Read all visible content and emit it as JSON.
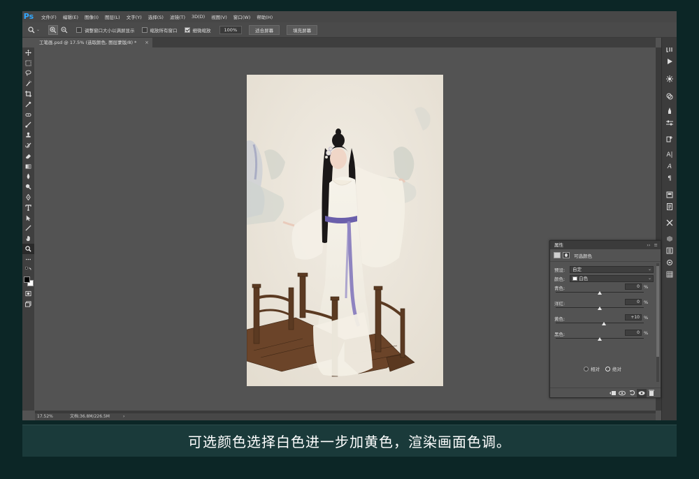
{
  "app": {
    "logo": "Ps",
    "menu": [
      "文件(F)",
      "编辑(E)",
      "图像(I)",
      "图层(L)",
      "文字(Y)",
      "选择(S)",
      "滤镜(T)",
      "3D(D)",
      "视图(V)",
      "窗口(W)",
      "帮助(H)"
    ]
  },
  "options": {
    "zoom_tool_icon": "zoom-icon",
    "resize_windows_label": "调整窗口大小以满屏显示",
    "resize_windows_checked": false,
    "zoom_all_label": "缩放所有窗口",
    "zoom_all_checked": false,
    "scrubby_label": "细微缩放",
    "scrubby_checked": true,
    "zoom_value": "100%",
    "fit_screen": "适合屏幕",
    "fill_screen": "填充屏幕"
  },
  "document": {
    "tab_title": "工笔画.psd @ 17.5% (选取颜色, 图层蒙版/8) *",
    "close": "×"
  },
  "statusbar": {
    "zoom": "17.52%",
    "doc_size": "文档:36.8M/226.5M",
    "arrow": "›"
  },
  "panel": {
    "tab": "属性",
    "collapse": "››",
    "menu": "≡",
    "title": "可选颜色",
    "preset_label": "预设:",
    "preset_value": "自定",
    "color_label": "颜色:",
    "color_value": "白色",
    "color_swatch": "#ffffff",
    "sliders": [
      {
        "label": "青色:",
        "value": "0",
        "unit": "%",
        "level": 0
      },
      {
        "label": "洋红:",
        "value": "0",
        "unit": "%",
        "level": 0
      },
      {
        "label": "黄色:",
        "value": "+10",
        "unit": "%",
        "level": 10
      },
      {
        "label": "黑色:",
        "value": "0",
        "unit": "%",
        "level": 0
      }
    ],
    "method": [
      {
        "label": "相对",
        "selected": false
      },
      {
        "label": "绝对",
        "selected": true
      }
    ]
  },
  "caption": "可选颜色选择白色进一步加黄色，渲染画面色调。",
  "colors": {
    "accent": "#31a8ff",
    "caption_bg": "#1a3a3a",
    "page_bg": "#0c2626"
  }
}
